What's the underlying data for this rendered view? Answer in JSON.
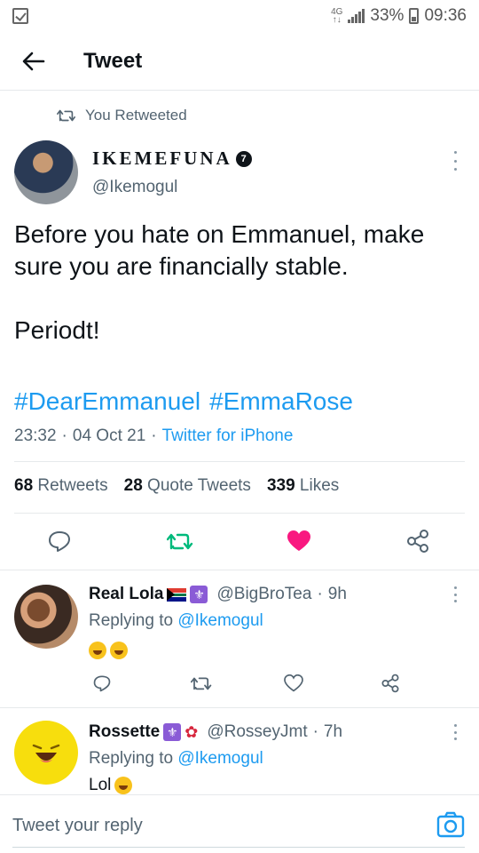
{
  "status_bar": {
    "network": "4G",
    "network_sub": "↑↓",
    "battery": "33%",
    "time": "09:36"
  },
  "header": {
    "back_icon": "arrow-left-icon",
    "title": "Tweet"
  },
  "tweet": {
    "retweet_notice": "You Retweeted",
    "author_name": "IKEMEFUNA",
    "author_badge": "7",
    "author_handle": "@Ikemogul",
    "text": "Before you hate on Emmanuel, make sure you are financially stable.\n\nPeriodt!",
    "hashtags": [
      "#DearEmmanuel",
      "#EmmaRose"
    ],
    "time": "23:32",
    "date": "04 Oct 21",
    "separator": "·",
    "source": "Twitter for iPhone",
    "stats": {
      "retweets_count": "68",
      "retweets_label": "Retweets",
      "quotes_count": "28",
      "quotes_label": "Quote Tweets",
      "likes_count": "339",
      "likes_label": "Likes"
    },
    "retweeted": true,
    "liked": true,
    "colors": {
      "accent": "#1d9bf0",
      "retweet": "#00ba7c",
      "like": "#f91880",
      "muted": "#536471"
    }
  },
  "replies": [
    {
      "name": "Real Lola",
      "handle": "@BigBroTea",
      "age": "9h",
      "replying_prefix": "Replying to",
      "replying_to": "@Ikemogul",
      "body_text": ""
    },
    {
      "name": "Rossette",
      "handle": "@RosseyJmt",
      "age": "7h",
      "replying_prefix": "Replying to",
      "replying_to": "@Ikemogul",
      "body_text": "Lol"
    }
  ],
  "reply_bar": {
    "placeholder": "Tweet your reply",
    "camera_icon": "camera-icon"
  }
}
